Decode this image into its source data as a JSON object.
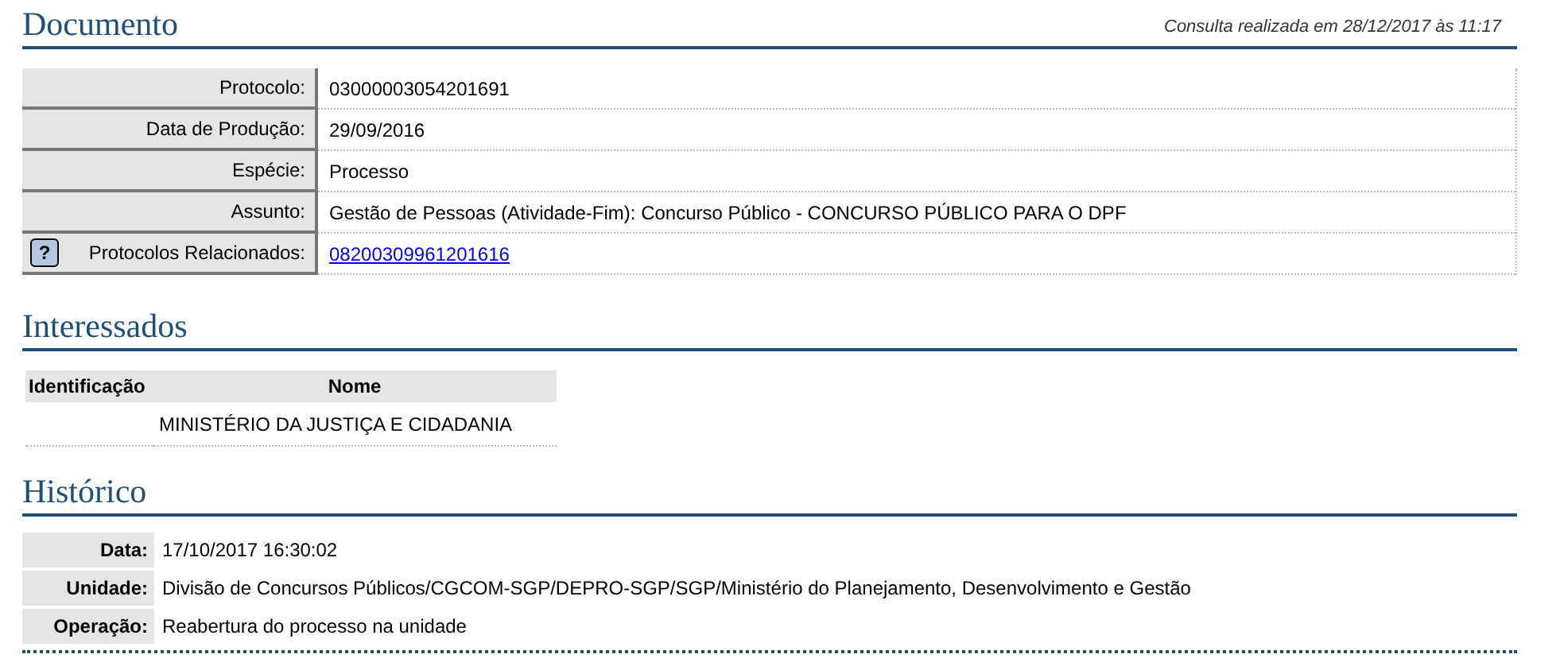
{
  "documento": {
    "title": "Documento",
    "consulta": "Consulta realizada em 28/12/2017 às 11:17",
    "fields": [
      {
        "label": "Protocolo:",
        "value": "03000003054201691",
        "kind": "text"
      },
      {
        "label": "Data de Produção:",
        "value": "29/09/2016",
        "kind": "text"
      },
      {
        "label": "Espécie:",
        "value": "Processo",
        "kind": "text"
      },
      {
        "label": "Assunto:",
        "value": "Gestão de Pessoas (Atividade-Fim): Concurso Público - CONCURSO PÚBLICO PARA O DPF",
        "kind": "text"
      },
      {
        "label": "Protocolos Relacionados:",
        "value": "08200309961201616",
        "kind": "link",
        "help": "?"
      }
    ]
  },
  "interessados": {
    "title": "Interessados",
    "columns": [
      "Identificação",
      "Nome"
    ],
    "rows": [
      [
        "",
        "MINISTÉRIO DA JUSTIÇA E CIDADANIA"
      ]
    ]
  },
  "historico": {
    "title": "Histórico",
    "fields": [
      {
        "label": "Data:",
        "value": "17/10/2017 16:30:02"
      },
      {
        "label": "Unidade:",
        "value": "Divisão de Concursos Públicos/CGCOM-SGP/DEPRO-SGP/SGP/Ministério do Planejamento, Desenvolvimento e Gestão"
      },
      {
        "label": "Operação:",
        "value": "Reabertura do processo na unidade"
      }
    ]
  }
}
